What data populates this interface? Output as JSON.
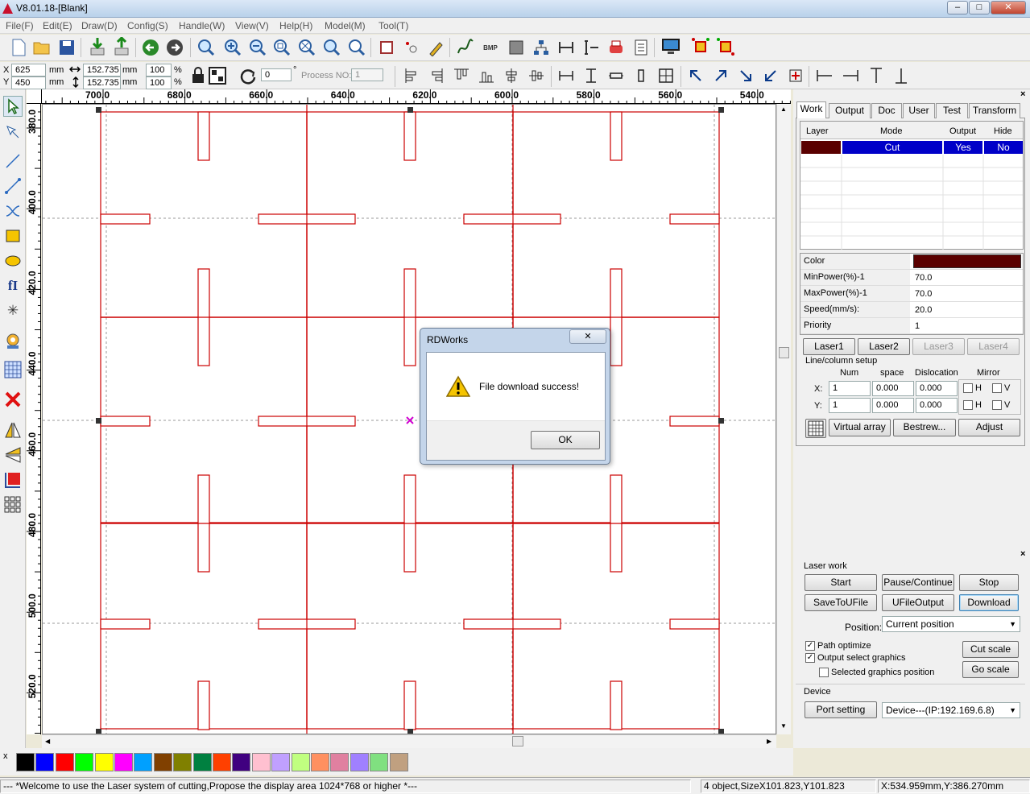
{
  "title": "V8.01.18-[Blank]",
  "menu": [
    "File(F)",
    "Edit(E)",
    "Draw(D)",
    "Config(S)",
    "Handle(W)",
    "View(V)",
    "Help(H)",
    "Model(M)",
    "Tool(T)"
  ],
  "coords": {
    "x_label": "X",
    "y_label": "Y",
    "x": "625",
    "y": "450",
    "unit": "mm",
    "w": "152.735",
    "h": "152.735",
    "w_unit": "mm",
    "h_unit": "mm",
    "sx": "100",
    "sy": "100",
    "pct": "%",
    "rot": "0",
    "deg": "°",
    "process_label": "Process NO:",
    "process_no": "1"
  },
  "ruler_h": [
    "700.0",
    "680.0",
    "660.0",
    "640.0",
    "620.0",
    "600.0",
    "580.0",
    "560.0",
    "540.0"
  ],
  "ruler_v": [
    "380.0",
    "400.0",
    "420.0",
    "440.0",
    "460.0",
    "480.0",
    "500.0",
    "520.0"
  ],
  "tabs": [
    "Work",
    "Output",
    "Doc",
    "User",
    "Test",
    "Transform"
  ],
  "layers": {
    "headers": [
      "Layer",
      "Mode",
      "Output",
      "Hide"
    ],
    "rows": [
      {
        "color": "#5a0000",
        "mode": "Cut",
        "output": "Yes",
        "hide": "No"
      }
    ]
  },
  "params": [
    {
      "label": "Color",
      "value": ""
    },
    {
      "label": "MinPower(%)-1",
      "value": "70.0"
    },
    {
      "label": "MaxPower(%)-1",
      "value": "70.0"
    },
    {
      "label": "Speed(mm/s):",
      "value": "20.0"
    },
    {
      "label": "Priority",
      "value": "1"
    }
  ],
  "layer_color": "#5a0000",
  "lasers": [
    "Laser1",
    "Laser2",
    "Laser3",
    "Laser4"
  ],
  "array": {
    "title": "Line/column setup",
    "h_num": "Num",
    "h_space": "space",
    "h_disl": "Dislocation",
    "h_mirror": "Mirror",
    "x_label": "X:",
    "y_label": "Y:",
    "x_num": "1",
    "x_space": "0.000",
    "x_disl": "0.000",
    "y_num": "1",
    "y_space": "0.000",
    "y_disl": "0.000",
    "h": "H",
    "v": "V",
    "virtual": "Virtual array",
    "bestrew": "Bestrew...",
    "adjust": "Adjust"
  },
  "laserwork": {
    "title": "Laser work",
    "start": "Start",
    "pause": "Pause/Continue",
    "stop": "Stop",
    "save": "SaveToUFile",
    "ufile": "UFileOutput",
    "download": "Download",
    "position_label": "Position:",
    "position": "Current position",
    "path_opt": "Path optimize",
    "out_sel": "Output select graphics",
    "sel_pos": "Selected graphics position",
    "cut_scale": "Cut scale",
    "go_scale": "Go scale",
    "device_label": "Device",
    "port": "Port setting",
    "device": "Device---(IP:192.169.6.8)"
  },
  "palette": [
    "#000000",
    "#0000ff",
    "#ff0000",
    "#00ff00",
    "#ffff00",
    "#ff00ff",
    "#00a0ff",
    "#804000",
    "#808000",
    "#008040",
    "#ff4000",
    "#400080",
    "#ffc0d0",
    "#c0a0ff",
    "#c0ff80",
    "#ff9060",
    "#e080a0",
    "#a080ff",
    "#80e080",
    "#c0a080"
  ],
  "palette_close": "x",
  "status": {
    "msg": "--- *Welcome to use the Laser system of cutting,Propose the display area 1024*768 or higher *---",
    "objects": "4 object,SizeX101.823,Y101.823",
    "pos": "X:534.959mm,Y:386.270mm"
  },
  "dialog": {
    "title": "RDWorks",
    "message": "File download success!",
    "ok": "OK"
  }
}
